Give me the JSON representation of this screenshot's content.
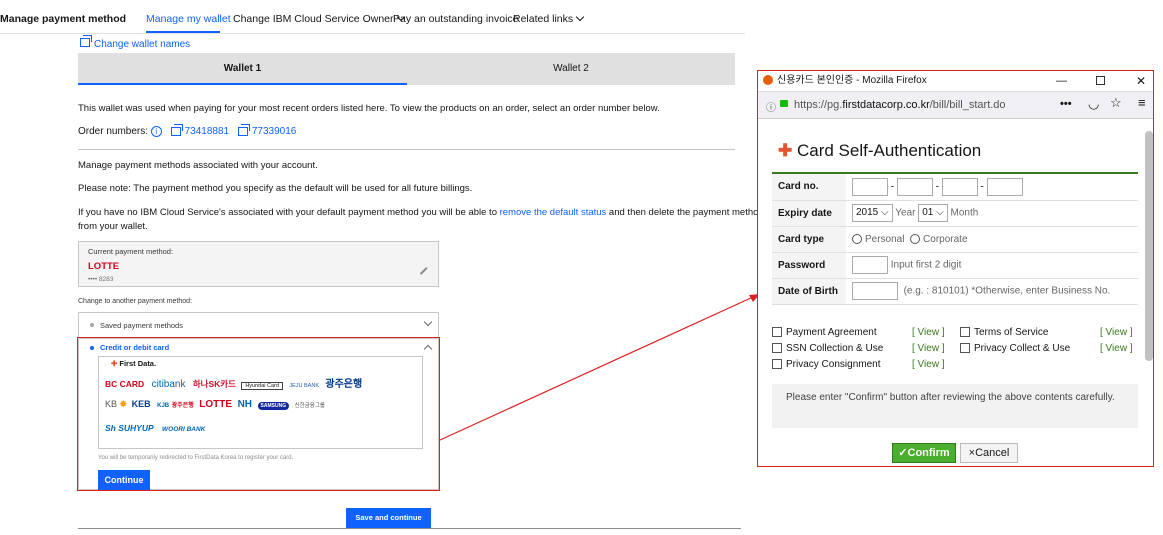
{
  "nav": {
    "title": "Manage payment method",
    "items": [
      {
        "label": "Manage my wallet"
      },
      {
        "label": "Change IBM Cloud Service Owner"
      },
      {
        "label": "Pay an outstanding invoice"
      },
      {
        "label": "Related links"
      }
    ]
  },
  "wallet": {
    "change_names": "Change wallet names",
    "tabs": [
      "Wallet 1",
      "Wallet 2"
    ],
    "desc": "This wallet was used when paying for your most recent orders listed here. To view the products on an order, select an order number below.",
    "order_label": "Order numbers:",
    "orders": [
      "73418881",
      "77339016"
    ],
    "manage_text": "Manage payment methods associated with your account.",
    "note": "Please note: The payment method you specify as the default will be used for all future billings.",
    "info_pre": "If you have no IBM Cloud Service's associated with your default payment method you will be able to ",
    "info_link": "remove the default status",
    "info_post": " and then delete the payment method",
    "info_line2": "from your wallet.",
    "current_label": "Current payment method:",
    "current_brand": "LOTTE",
    "current_number": "•••• 8283",
    "change_label": "Change to another payment method:",
    "saved_methods": "Saved payment methods",
    "credit_debit": "Credit or debit card",
    "firstdata": "First Data.",
    "banks_row1": [
      "BC CARD",
      "citibank",
      "하나SK카드",
      "Hyundai Card",
      "JEJU BANK",
      "광주은행"
    ],
    "banks_row2": [
      "KB",
      "KEB",
      "KJB",
      "광주은행",
      "LOTTE",
      "NH",
      "SAMSUNG",
      "신한금융그룹"
    ],
    "banks_row3": [
      "Sh SUHYUP",
      "WOORI BANK"
    ],
    "redirect_note": "You will be temporarily redirected to FirstData Korea to register your card.",
    "continue": "Continue",
    "save_continue": "Save and continue"
  },
  "popup": {
    "window_title": "신용카드 본인인증 - Mozilla Firefox",
    "url_prefix": "https://pg.",
    "url_domain": "firstdatacorp.co.kr",
    "url_path": "/bill/bill_start.do",
    "url_more": "•••",
    "heading": "Card Self-Authentication",
    "fields": {
      "card_no": "Card no.",
      "expiry": "Expiry date",
      "year_value": "2015",
      "year_label": "Year",
      "month_value": "01",
      "month_label": "Month",
      "card_type": "Card type",
      "personal": "Personal",
      "corporate": "Corporate",
      "password": "Password",
      "password_hint": "Input first 2 digit",
      "dob": "Date of Birth",
      "dob_hint": "(e.g. : 810101) *Otherwise, enter Business No."
    },
    "agreements": [
      {
        "label": "Payment Agreement",
        "view": "[ View ]"
      },
      {
        "label": "Terms of Service",
        "view": "[ View ]"
      },
      {
        "label": "SSN Collection & Use",
        "view": "[ View ]"
      },
      {
        "label": "Privacy Collect & Use",
        "view": "[ View ]"
      },
      {
        "label": "Privacy Consignment",
        "view": "[ View ]"
      }
    ],
    "notice": "Please enter \"Confirm\" button after reviewing the above contents carefully.",
    "confirm": "Confirm",
    "cancel": "Cancel"
  }
}
